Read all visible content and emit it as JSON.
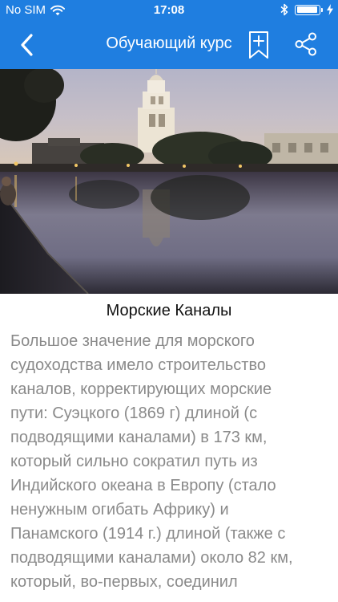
{
  "status_bar": {
    "carrier": "No SIM",
    "time": "17:08",
    "battery_level": 0.95
  },
  "nav": {
    "title": "Обучающий курс",
    "back_icon": "chevron-left-icon",
    "bookmark_icon": "bookmark-add-icon",
    "share_icon": "share-icon"
  },
  "colors": {
    "header": "#1f7ee0",
    "title_text": "#111111",
    "body_text": "#8a8a8a"
  },
  "article": {
    "title": "Морские Каналы",
    "body_lines": [
      "Большое значение для морского",
      "судоходства имело строительство",
      "каналов, корректирующих морские",
      "пути: Суэцкого (1869 г) длиной (с",
      "подводящими каналами) в 173 км,",
      "который сильно сократил путь из",
      "Индийского океана в Европу (стало",
      "ненужным огибать Африку) и",
      "Панамского (1914 г.) длиной (также с",
      "подводящими каналами) около 82 км,",
      "который, во-первых, соединил"
    ]
  }
}
